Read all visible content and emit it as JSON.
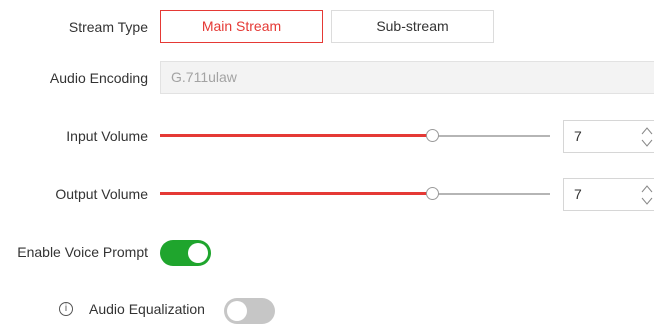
{
  "stream_type": {
    "label": "Stream Type",
    "options": [
      "Main Stream",
      "Sub-stream"
    ],
    "selected": "Main Stream"
  },
  "audio_encoding": {
    "label": "Audio Encoding",
    "value": "G.711ulaw"
  },
  "input_volume": {
    "label": "Input Volume",
    "value": "7",
    "level": 0.7
  },
  "output_volume": {
    "label": "Output Volume",
    "value": "7",
    "level": 0.7
  },
  "voice_prompt": {
    "label": "Enable Voice Prompt",
    "enabled": true
  },
  "audio_equalization": {
    "icon": "info-icon",
    "label": "Audio Equalization",
    "enabled": false
  },
  "colors": {
    "accent": "#e53935",
    "toggle_on": "#1fa52d",
    "toggle_off": "#c6c6c6"
  }
}
